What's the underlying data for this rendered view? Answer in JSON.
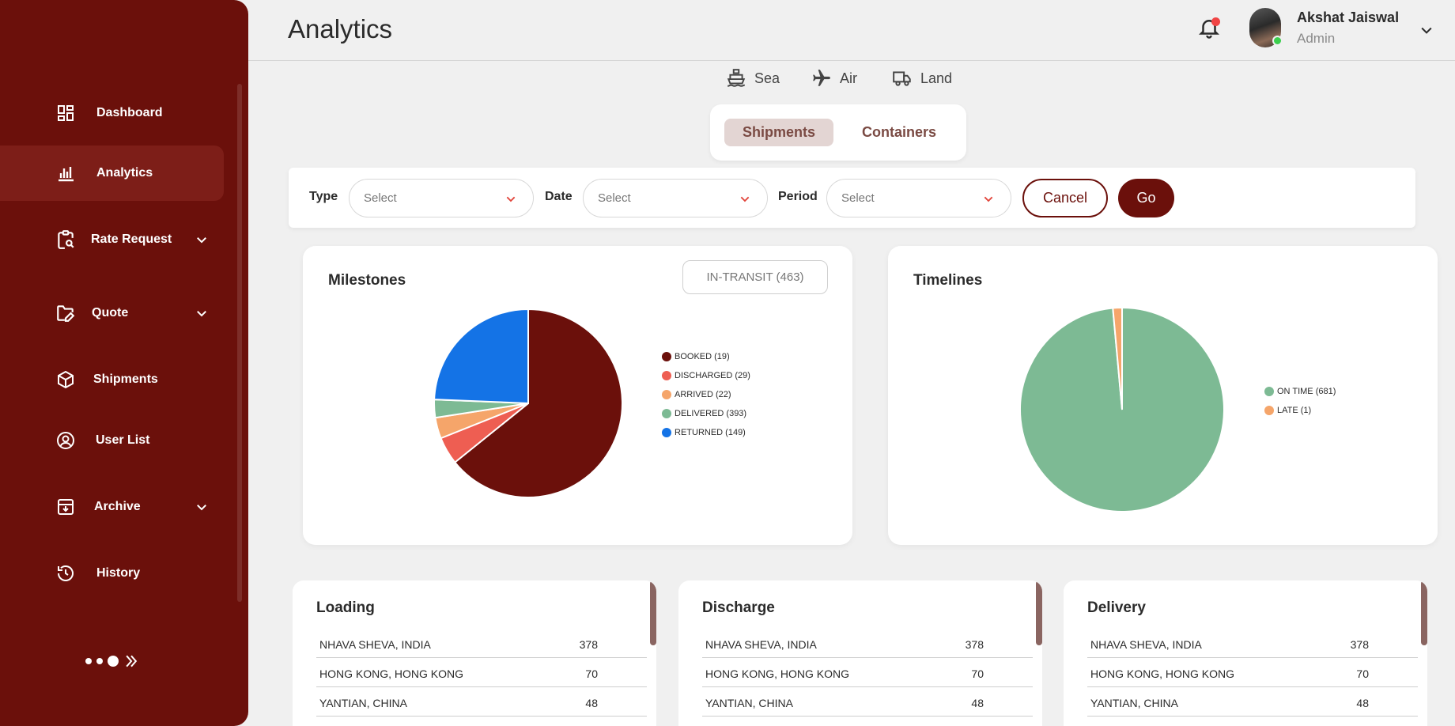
{
  "sidebar": {
    "items": [
      {
        "label": "Dashboard"
      },
      {
        "label": "Analytics"
      },
      {
        "label": "Rate Request"
      },
      {
        "label": "Quote"
      },
      {
        "label": "Shipments"
      },
      {
        "label": "User List"
      },
      {
        "label": "Archive"
      },
      {
        "label": "History"
      }
    ]
  },
  "header": {
    "title": "Analytics",
    "user_name": "Akshat Jaiswal",
    "user_role": "Admin"
  },
  "modes": [
    {
      "label": "Sea",
      "icon": "ship-icon"
    },
    {
      "label": "Air",
      "icon": "airplane-icon"
    },
    {
      "label": "Land",
      "icon": "truck-icon"
    }
  ],
  "segments": {
    "shipments": "Shipments",
    "containers": "Containers"
  },
  "filters": {
    "type_label": "Type",
    "type_value": "Select",
    "date_label": "Date",
    "date_value": "Select",
    "period_label": "Period",
    "period_value": "Select",
    "cancel": "Cancel",
    "go": "Go"
  },
  "milestones": {
    "title": "Milestones",
    "chip": "IN-TRANSIT (463)"
  },
  "timelines": {
    "title": "Timelines"
  },
  "chart_data": [
    {
      "type": "pie",
      "title": "Milestones",
      "labels": [
        "BOOKED (19)",
        "DISCHARGED (29)",
        "ARRIVED (22)",
        "DELIVERED (393)",
        "RETURNED (149)"
      ],
      "values": [
        393,
        29,
        22,
        19,
        149
      ],
      "slice_order_clockwise_from_top": [
        "dark-red",
        "coral",
        "orange",
        "green",
        "blue"
      ],
      "colors": [
        "#6b100b",
        "#ee5e52",
        "#f5a56a",
        "#7dba94",
        "#1473e6"
      ],
      "legend_position": "right"
    },
    {
      "type": "pie",
      "title": "Timelines",
      "labels": [
        "ON TIME (681)",
        "LATE (1)"
      ],
      "values": [
        681,
        10
      ],
      "colors": [
        "#7dba94",
        "#f5a56a"
      ],
      "legend_position": "right"
    }
  ],
  "tables": [
    {
      "title": "Loading",
      "rows": [
        {
          "location": "NHAVA SHEVA, INDIA",
          "count": "378"
        },
        {
          "location": "HONG KONG, HONG KONG",
          "count": "70"
        },
        {
          "location": "YANTIAN, CHINA",
          "count": "48"
        }
      ]
    },
    {
      "title": "Discharge",
      "rows": [
        {
          "location": "NHAVA SHEVA, INDIA",
          "count": "378"
        },
        {
          "location": "HONG KONG, HONG KONG",
          "count": "70"
        },
        {
          "location": "YANTIAN, CHINA",
          "count": "48"
        }
      ]
    },
    {
      "title": "Delivery",
      "rows": [
        {
          "location": "NHAVA SHEVA, INDIA",
          "count": "378"
        },
        {
          "location": "HONG KONG, HONG KONG",
          "count": "70"
        },
        {
          "location": "YANTIAN, CHINA",
          "count": "48"
        }
      ]
    }
  ],
  "colors": {
    "brand": "#6b100b",
    "background": "#f0f0f0"
  }
}
